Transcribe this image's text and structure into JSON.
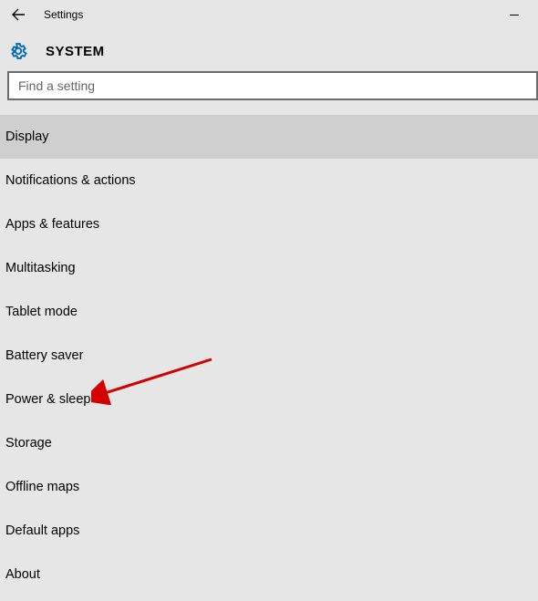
{
  "titlebar": {
    "title": "Settings"
  },
  "header": {
    "page_title": "SYSTEM"
  },
  "search": {
    "placeholder": "Find a setting",
    "value": ""
  },
  "list": {
    "items": [
      {
        "label": "Display",
        "selected": true
      },
      {
        "label": "Notifications & actions",
        "selected": false
      },
      {
        "label": "Apps & features",
        "selected": false
      },
      {
        "label": "Multitasking",
        "selected": false
      },
      {
        "label": "Tablet mode",
        "selected": false
      },
      {
        "label": "Battery saver",
        "selected": false
      },
      {
        "label": "Power & sleep",
        "selected": false
      },
      {
        "label": "Storage",
        "selected": false
      },
      {
        "label": "Offline maps",
        "selected": false
      },
      {
        "label": "Default apps",
        "selected": false
      },
      {
        "label": "About",
        "selected": false
      }
    ]
  }
}
